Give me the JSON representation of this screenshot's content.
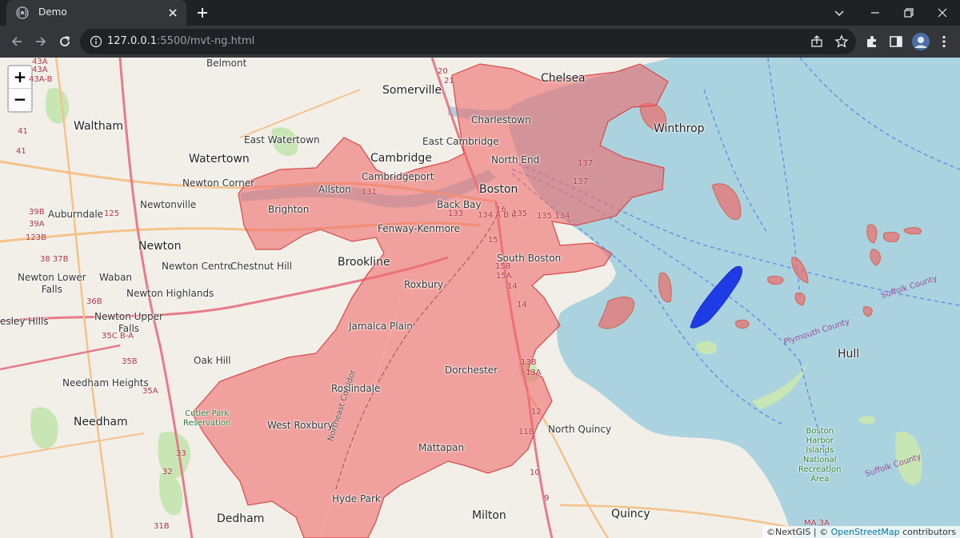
{
  "browser": {
    "tab_title": "Demo",
    "url_host": "127.0.0.1",
    "url_rest": ":5500/mvt-ng.html"
  },
  "map": {
    "zoom_in_label": "+",
    "zoom_out_label": "−",
    "attribution_prefix": "©NextGIS | © ",
    "attribution_link": "OpenStreetMap",
    "attribution_suffix": " contributors",
    "highlight_fill": "#ee6a6a",
    "selected_fill": "#1e3ce6",
    "water_color": "#aad3df",
    "labels": {
      "belmont": "Belmont",
      "somerville": "Somerville",
      "chelsea": "Chelsea",
      "charlestown": "Charlestown",
      "winthrop": "Winthrop",
      "waltham": "Waltham",
      "east_watertown": "East Watertown",
      "east_cambridge": "East Cambridge",
      "cambridge": "Cambridge",
      "watertown": "Watertown",
      "north_end": "North End",
      "cambridgeport": "Cambridgeport",
      "newton_corner": "Newton Corner",
      "allston": "Allston",
      "boston": "Boston",
      "auburndale": "Auburndale",
      "newtonville": "Newtonville",
      "brighton": "Brighton",
      "back_bay": "Back Bay",
      "fenway_kenmore": "Fenway-Kenmore",
      "newton": "Newton",
      "newton_centre": "Newton Centre",
      "chestnut_hill": "Chestnut Hill",
      "brookline": "Brookline",
      "south_boston": "South Boston",
      "newton_lower_falls": "Newton Lower\nFalls",
      "waban": "Waban",
      "roxbury": "Roxbury",
      "newton_highlands": "Newton Highlands",
      "newton_upper_falls": "Newton Upper\nFalls",
      "wellesley_hills": "esley Hills",
      "jamaica_plain": "Jamaica Plain",
      "oak_hill": "Oak Hill",
      "dorchester": "Dorchester",
      "hull": "Hull",
      "needham_heights": "Needham Heights",
      "roslindale": "Roslindale",
      "needham": "Needham",
      "west_roxbury": "West Roxbury",
      "north_quincy": "North Quincy",
      "mattapan": "Mattapan",
      "hyde_park": "Hyde Park",
      "milton": "Milton",
      "quincy": "Quincy",
      "dedham": "Dedham",
      "cutler_park": "Cutler Park\nReservation",
      "boston_harbor_islands": "Boston\nHarbor\nIslands\nNational\nRecreation\nArea",
      "northeast_corridor": "Northeast Corridor",
      "suffolk_county_1": "Suffolk County",
      "suffolk_county_2": "Suffolk County",
      "plymouth_county": "Plymouth County"
    },
    "route_labels": {
      "r43a": "43A",
      "r43a2": "43A",
      "r43ab": "43A-B",
      "r41": "41",
      "r41b": "41",
      "r39b": "39B",
      "r39a": "39A",
      "r123b": "123B",
      "r125": "125",
      "r38": "38 37B",
      "r36b": "36B",
      "r35c": "35C B-A",
      "r35b": "35B",
      "r35a": "35A",
      "r33": "33",
      "r32": "32",
      "r31b": "31B",
      "r20": "20",
      "r21": "21",
      "r16": "16",
      "r131": "131",
      "r133": "133",
      "r134": "134 A B C",
      "r135": "135",
      "r135b": "135 134",
      "r15": "15",
      "r15b": "15B",
      "r15a": "15A",
      "r14": "14",
      "r14b": "14",
      "r13b": "13B",
      "r13a": "13A",
      "r12": "12",
      "r11b": "11B",
      "r10": "10",
      "r9": "9",
      "r137": "137",
      "r137b": "137",
      "ma3a": "MA 3A"
    }
  }
}
